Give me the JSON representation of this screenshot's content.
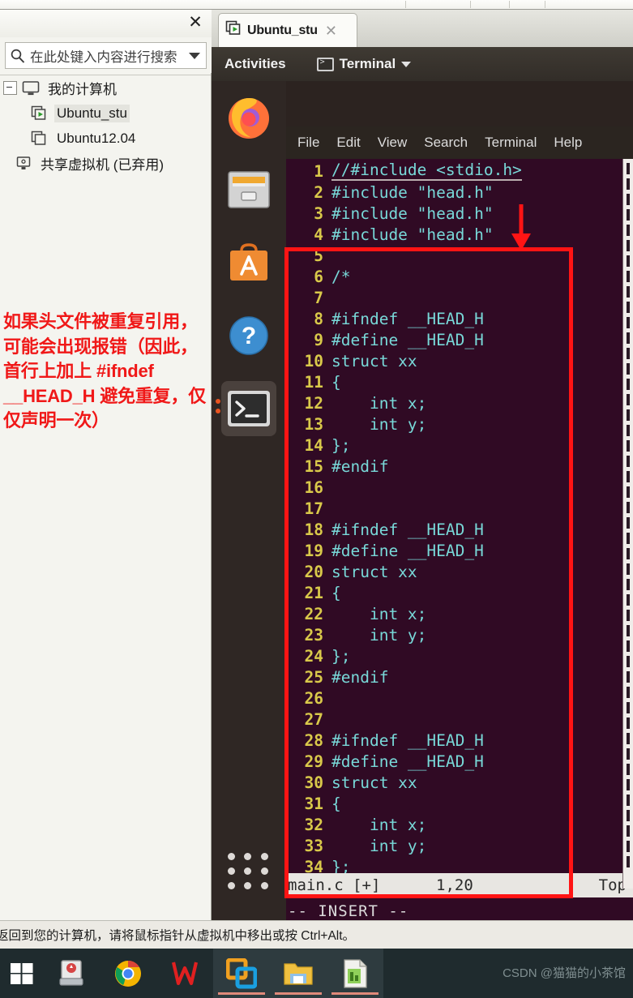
{
  "library_pane": {
    "close_label": "✕",
    "search": {
      "placeholder": "在此处键入内容进行搜索",
      "icon": "search-icon",
      "dropdown_icon": "chevron-down-icon"
    },
    "tree": [
      {
        "label": "我的计算机",
        "icon": "monitor-icon",
        "level": 0,
        "selected": false,
        "expander": true
      },
      {
        "label": "Ubuntu_stu",
        "icon": "vm-running-icon",
        "level": 1,
        "selected": true,
        "expander": false
      },
      {
        "label": "Ubuntu12.04",
        "icon": "vm-icon",
        "level": 1,
        "selected": false,
        "expander": false
      },
      {
        "label": "共享虚拟机 (已弃用)",
        "icon": "shared-vm-icon",
        "level": 0,
        "selected": false,
        "expander": false
      }
    ]
  },
  "vm_tab": {
    "title": "Ubuntu_stu",
    "icon": "vm-running-icon",
    "close_label": "✕"
  },
  "gnome": {
    "activities": "Activities",
    "app_name": "Terminal",
    "app_icon": "terminal-icon",
    "menu_arrow": "chevron-down-icon",
    "dock": [
      {
        "name": "firefox-icon",
        "label": "Firefox",
        "active": false
      },
      {
        "name": "files-icon",
        "label": "Files",
        "active": false
      },
      {
        "name": "ubuntu-software-icon",
        "label": "Ubuntu Software",
        "active": false
      },
      {
        "name": "help-icon",
        "label": "Help",
        "active": false
      },
      {
        "name": "terminal-icon",
        "label": "Terminal",
        "active": true
      }
    ],
    "show_apps": "show-applications-icon"
  },
  "terminal": {
    "menu": [
      "File",
      "Edit",
      "View",
      "Search",
      "Terminal",
      "Help"
    ],
    "lines": [
      {
        "n": "1",
        "text": "//#include <stdio.h>",
        "cls": "cmt",
        "underline": true
      },
      {
        "n": "2",
        "text": "#include \"head.h\"",
        "cls": "kw"
      },
      {
        "n": "3",
        "text": "#include \"head.h\"",
        "cls": "kw"
      },
      {
        "n": "4",
        "text": "#include \"head.h\"",
        "cls": "kw"
      },
      {
        "n": "5",
        "text": ""
      },
      {
        "n": "6",
        "text": "/*",
        "cls": "cmt"
      },
      {
        "n": "7",
        "text": ""
      },
      {
        "n": "8",
        "text": "#ifndef __HEAD_H",
        "cls": "kw"
      },
      {
        "n": "9",
        "text": "#define __HEAD_H",
        "cls": "kw"
      },
      {
        "n": "10",
        "text": "struct xx"
      },
      {
        "n": "11",
        "text": "{"
      },
      {
        "n": "12",
        "text": "    int x;"
      },
      {
        "n": "13",
        "text": "    int y;"
      },
      {
        "n": "14",
        "text": "};"
      },
      {
        "n": "15",
        "text": "#endif",
        "cls": "kw"
      },
      {
        "n": "16",
        "text": ""
      },
      {
        "n": "17",
        "text": ""
      },
      {
        "n": "18",
        "text": "#ifndef __HEAD_H",
        "cls": "kw"
      },
      {
        "n": "19",
        "text": "#define __HEAD_H",
        "cls": "kw"
      },
      {
        "n": "20",
        "text": "struct xx"
      },
      {
        "n": "21",
        "text": "{"
      },
      {
        "n": "22",
        "text": "    int x;"
      },
      {
        "n": "23",
        "text": "    int y;"
      },
      {
        "n": "24",
        "text": "};"
      },
      {
        "n": "25",
        "text": "#endif",
        "cls": "kw"
      },
      {
        "n": "26",
        "text": ""
      },
      {
        "n": "27",
        "text": ""
      },
      {
        "n": "28",
        "text": "#ifndef __HEAD_H",
        "cls": "kw"
      },
      {
        "n": "29",
        "text": "#define __HEAD_H",
        "cls": "kw"
      },
      {
        "n": "30",
        "text": "struct xx"
      },
      {
        "n": "31",
        "text": "{"
      },
      {
        "n": "32",
        "text": "    int x;"
      },
      {
        "n": "33",
        "text": "    int y;"
      },
      {
        "n": "34",
        "text": "};"
      }
    ],
    "status": {
      "file": "main.c [+]",
      "position": "1,20",
      "scroll": "Top"
    },
    "mode": "-- INSERT --"
  },
  "annotation": {
    "text": "如果头文件被重复引用，可能会出现报错（因此，首行上加上 #ifndef __HEAD_H 避免重复，仅仅声明一次）",
    "color": "#f01818",
    "rect_color": "#ff1414",
    "arrow": "down-arrow-icon"
  },
  "hint_bar": {
    "text": "返回到您的计算机，请将鼠标指针从虚拟机中移出或按 Ctrl+Alt。"
  },
  "taskbar": {
    "items": [
      {
        "name": "start-button",
        "label": "开始",
        "active": false
      },
      {
        "name": "backup-tool-icon",
        "label": "备份工具",
        "active": false
      },
      {
        "name": "chrome-icon",
        "label": "Google Chrome",
        "active": false
      },
      {
        "name": "wps-icon",
        "label": "WPS",
        "active": false
      },
      {
        "name": "vmware-icon",
        "label": "VMware Workstation",
        "active": true
      },
      {
        "name": "file-explorer-icon",
        "label": "文件资源管理器",
        "active": true
      },
      {
        "name": "spreadsheet-icon",
        "label": "表格",
        "active": true
      }
    ],
    "watermark": "CSDN @猫猫的小茶馆"
  }
}
